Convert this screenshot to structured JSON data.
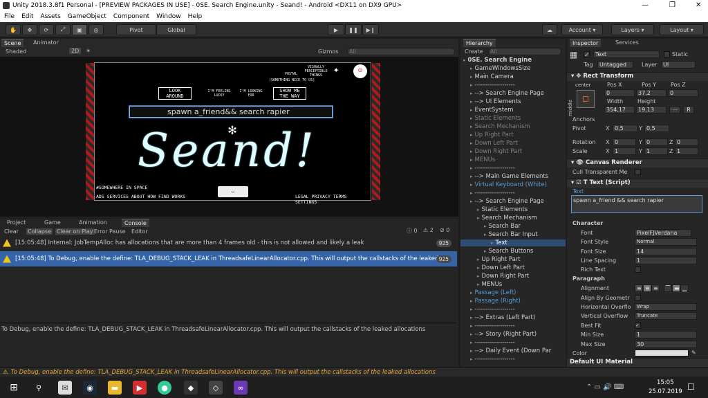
{
  "window": {
    "title": "Unity 2018.3.8f1 Personal - [PREVIEW PACKAGES IN USE] - 0SE. Search Engine.unity - Seand! - Android <DX11 on DX9 GPU>",
    "minimize": "—",
    "maximize": "❐",
    "close": "✕"
  },
  "menu": [
    "File",
    "Edit",
    "Assets",
    "GameObject",
    "Component",
    "Window",
    "Help"
  ],
  "toolbar": {
    "pivot": "Pivot",
    "global": "Global",
    "account": "Account",
    "layers": "Layers",
    "layout": "Layout"
  },
  "scene": {
    "tabs": [
      "Scene",
      "Animator"
    ],
    "shading": "Shaded",
    "mode2d": "2D",
    "gizmos": "Gizmos",
    "search_placeholder": "All"
  },
  "game": {
    "visually_perceptible": "VISUALLY PERCEPTIBLE THINGS",
    "postal": "POSTAL",
    "something_nice": "(SOMETHING NICE TO US)",
    "btn_look": "LOOK AROUND",
    "btn_lucky": "I'M FEELING LUCKY",
    "btn_looking": "I'M LOOKING FOR",
    "btn_show": "SHOW ME THE WAY",
    "search_text": "spawn a_friend&& search rapier",
    "logo": "Seand!",
    "somewhere": "#SOMEWHERE IN SPACE",
    "footer_left": "ADS SERVICES ABOUT HOW FIND WORKS",
    "footer_right": "LEGAL PRIVACY TERMS SETTINGS"
  },
  "console": {
    "tabs": [
      "Project",
      "Game",
      "Animation",
      "Console"
    ],
    "buttons": [
      "Clear",
      "Collapse",
      "Clear on Play",
      "Error Pause",
      "Editor"
    ],
    "counts": {
      "info": "0",
      "warn": "2",
      "error": "0"
    },
    "logs": [
      {
        "text": "[15:05:48] Internal: JobTempAlloc has allocations that are more than 4 frames old - this is not allowed and likely a leak",
        "count": "925"
      },
      {
        "text": "[15:05:48] To Debug, enable the define: TLA_DEBUG_STACK_LEAK in ThreadsafeLinearAllocator.cpp. This will output the callstacks of the leaked allocations",
        "count": "925"
      }
    ],
    "detail": "To Debug, enable the define: TLA_DEBUG_STACK_LEAK in ThreadsafeLinearAllocator.cpp. This will output the callstacks of the leaked allocations"
  },
  "hierarchy": {
    "title": "Hierarchy",
    "create": "Create",
    "search_placeholder": "All",
    "items": [
      {
        "label": "0SE. Search Engine",
        "style": "root"
      },
      {
        "label": "GameWindowsSize",
        "style": ""
      },
      {
        "label": "Main Camera",
        "style": ""
      },
      {
        "label": "-------------------",
        "style": ""
      },
      {
        "label": "--> Search Engine Page",
        "style": ""
      },
      {
        "label": "--> UI Elements",
        "style": ""
      },
      {
        "label": "EventSystem",
        "style": ""
      },
      {
        "label": "Static Elements",
        "style": "dim"
      },
      {
        "label": "Search Mechanism",
        "style": "dim"
      },
      {
        "label": "Up Right Part",
        "style": "dim"
      },
      {
        "label": "Down Left Part",
        "style": "dim"
      },
      {
        "label": "Down Right Part",
        "style": "dim"
      },
      {
        "label": "MENUs",
        "style": "dim"
      },
      {
        "label": "-------------------",
        "style": ""
      },
      {
        "label": "--> Main Game Elements",
        "style": ""
      },
      {
        "label": "Virtual Keyboard (White)",
        "style": "blue"
      },
      {
        "label": "-------------------",
        "style": ""
      },
      {
        "label": "--> Search Engine Page",
        "style": ""
      },
      {
        "label": "Static Elements",
        "style": ""
      },
      {
        "label": "Search Mechanism",
        "style": ""
      },
      {
        "label": "Search Bar",
        "style": ""
      },
      {
        "label": "Search Bar Input",
        "style": ""
      },
      {
        "label": "Text",
        "style": "sel"
      },
      {
        "label": "Search Buttons",
        "style": ""
      },
      {
        "label": "Up Right Part",
        "style": ""
      },
      {
        "label": "Down Left Part",
        "style": ""
      },
      {
        "label": "Down Right Part",
        "style": ""
      },
      {
        "label": "MENUs",
        "style": ""
      },
      {
        "label": "Passage (Left)",
        "style": "blue"
      },
      {
        "label": "Passage (Right)",
        "style": "blue"
      },
      {
        "label": "-------------------",
        "style": ""
      },
      {
        "label": "--> Extras (Left Part)",
        "style": ""
      },
      {
        "label": "-------------------",
        "style": ""
      },
      {
        "label": "--> Story (Right Part)",
        "style": ""
      },
      {
        "label": "-------------------",
        "style": ""
      },
      {
        "label": "--> Daily Event (Down Par",
        "style": ""
      },
      {
        "label": "-------------------",
        "style": ""
      }
    ]
  },
  "inspector": {
    "tabs": [
      "Inspector",
      "Services"
    ],
    "object_name": "Text",
    "static": "Static",
    "tag_label": "Tag",
    "tag": "Untagged",
    "layer_label": "Layer",
    "layer": "UI",
    "rect_transform": "Rect Transform",
    "anchor_h": "center",
    "anchor_v": "middle",
    "pos_x_label": "Pos X",
    "pos_y_label": "Pos Y",
    "pos_z_label": "Pos Z",
    "pos_x": "0",
    "pos_y": "37,2",
    "pos_z": "0",
    "width_label": "Width",
    "height_label": "Height",
    "width": "354,17",
    "height": "19,13",
    "r_button": "R",
    "anchors": "Anchors",
    "pivot_label": "Pivot",
    "pivot_x": "0,5",
    "pivot_y": "0,5",
    "rotation_label": "Rotation",
    "rot_x": "0",
    "rot_y": "0",
    "rot_z": "0",
    "scale_label": "Scale",
    "scale_x": "1",
    "scale_y": "1",
    "scale_z": "1",
    "canvas_renderer": "Canvas Renderer",
    "cull": "Cull Transparent Me",
    "text_script": "Text (Script)",
    "text_label": "Text",
    "text_value": "spawn a_friend && search rapier",
    "character": "Character",
    "font_label": "Font",
    "font": "PixelFJVerdana",
    "font_style_label": "Font Style",
    "font_style": "Normal",
    "font_size_label": "Font Size",
    "font_size": "14",
    "line_spacing_label": "Line Spacing",
    "line_spacing": "1",
    "rich_text_label": "Rich Text",
    "paragraph": "Paragraph",
    "alignment_label": "Alignment",
    "align_geom_label": "Align By Geometr",
    "h_overflow_label": "Horizontal Overflo",
    "h_overflow": "Wrap",
    "v_overflow_label": "Vertical Overflow",
    "v_overflow": "Truncate",
    "best_fit_label": "Best Fit",
    "min_size_label": "Min Size",
    "min_size": "1",
    "max_size_label": "Max Size",
    "max_size": "30",
    "color_label": "Color",
    "default_material": "Default UI Material"
  },
  "status": "To Debug, enable the define: TLA_DEBUG_STACK_LEAK in ThreadsafeLinearAllocator.cpp. This will output the callstacks of the leaked allocations",
  "taskbar": {
    "time": "15:05",
    "date": "25.07.2019"
  }
}
